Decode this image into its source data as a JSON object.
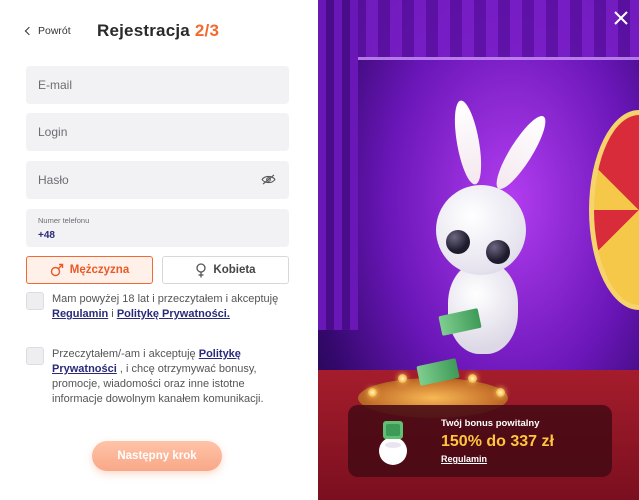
{
  "header": {
    "back_label": "Powrót",
    "title": "Rejestracja",
    "step": "2/3"
  },
  "form": {
    "email_placeholder": "E-mail",
    "login_placeholder": "Login",
    "password_placeholder": "Hasło",
    "phone_label": "Numer telefonu",
    "phone_prefix": "+48"
  },
  "gender": {
    "male_label": "Mężczyzna",
    "female_label": "Kobieta",
    "selected": "male"
  },
  "consents": {
    "age": {
      "text_before": "Mam powyżej 18 lat i przeczytałem i akceptuję",
      "terms_link": "Regulamin",
      "and": "i",
      "privacy_link": "Politykę Prywatności."
    },
    "marketing": {
      "text_before": "Przeczytałem/-am i akceptuję",
      "privacy_link": "Politykę Prywatności",
      "text_after": ", i chcę otrzymywać bonusy, promocje, wiadomości oraz inne istotne informacje dowolnym kanałem komunikacji."
    }
  },
  "next_button_label": "Następny krok",
  "bonus": {
    "title": "Twój bonus powitalny",
    "amount": "150% do 337 zł",
    "link": "Regulamin"
  },
  "colors": {
    "accent": "#f26b2e",
    "link": "#2a2a7a",
    "bonus_amount": "#ffc53d",
    "next_button": "#f8a887"
  },
  "icons": {
    "back": "chevron-left-icon",
    "password_toggle": "eye-off-icon",
    "male": "male-symbol-icon",
    "female": "female-symbol-icon",
    "close": "close-icon"
  }
}
